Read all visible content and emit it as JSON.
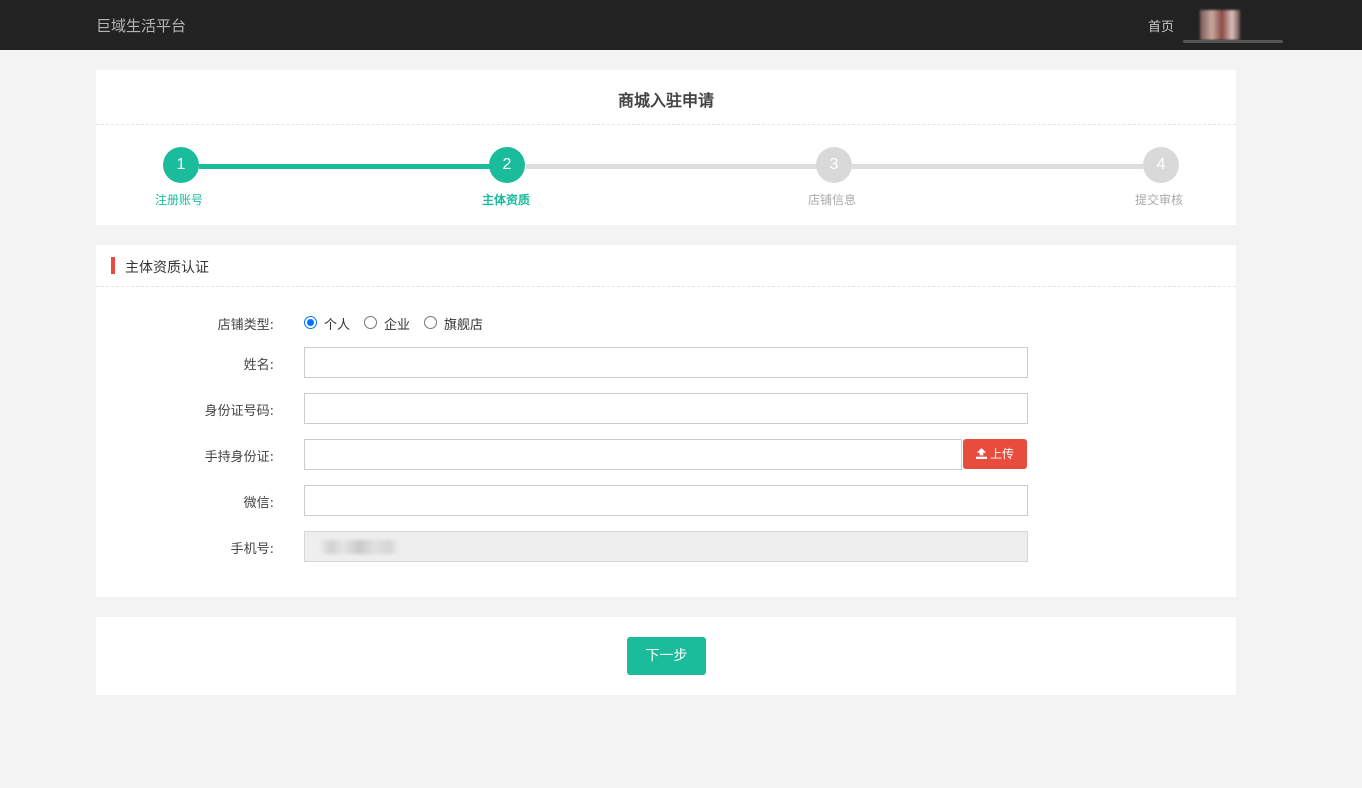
{
  "header": {
    "brand": "巨域生活平台",
    "nav_home": "首页"
  },
  "page_title": "商城入驻申请",
  "steps": [
    {
      "number": "1",
      "label": "注册账号",
      "status": "done"
    },
    {
      "number": "2",
      "label": "主体资质",
      "status": "active"
    },
    {
      "number": "3",
      "label": "店铺信息",
      "status": "pending"
    },
    {
      "number": "4",
      "label": "提交审核",
      "status": "pending"
    }
  ],
  "section": {
    "title": "主体资质认证"
  },
  "form": {
    "shop_type_label": "店铺类型:",
    "shop_type_options": [
      "个人",
      "企业",
      "旗舰店"
    ],
    "shop_type_selected": "个人",
    "name_label": "姓名:",
    "name_value": "",
    "id_number_label": "身份证号码:",
    "id_number_value": "",
    "id_photo_label": "手持身份证:",
    "id_photo_value": "",
    "upload_label": "上传",
    "wechat_label": "微信:",
    "wechat_value": "",
    "phone_label": "手机号:"
  },
  "next_button": "下一步",
  "colors": {
    "accent": "#1abc9c",
    "danger": "#e74c3c",
    "topbar": "#222222",
    "pending": "#d9d9d9"
  },
  "icons": {
    "upload": "upload-icon",
    "avatar": "user-avatar"
  }
}
